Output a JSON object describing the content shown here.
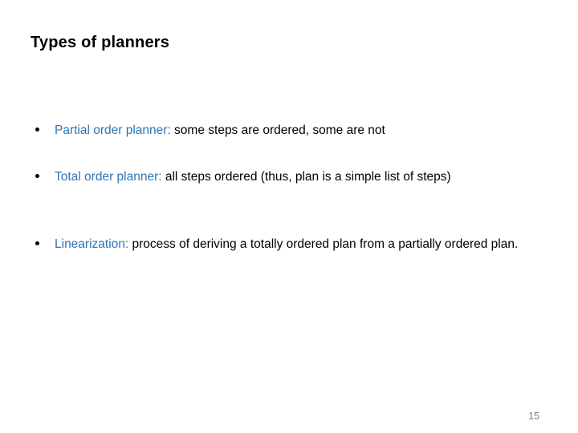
{
  "slide": {
    "title": "Types of planners",
    "page_number": "15",
    "accent_color": "#2E75B6",
    "text_color": "#000000",
    "background_color": "#FFFFFF",
    "page_number_color": "#808080",
    "bullets": [
      {
        "marker": "bullet-dot",
        "term": "Partial order planner:",
        "description": " some steps are ordered, some are not"
      },
      {
        "marker": "bullet-dot",
        "term": "Total order planner:",
        "description": " all steps ordered (thus, plan is a simple list of steps)"
      },
      {
        "marker": "bullet-dot",
        "term": "Linearization:",
        "description": " process of deriving a totally ordered plan from a partially ordered plan."
      }
    ]
  }
}
